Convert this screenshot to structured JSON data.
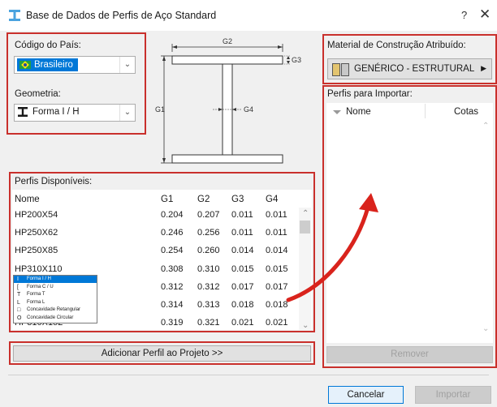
{
  "window": {
    "title": "Base de Dados de Perfis de Aço Standard",
    "help": "?",
    "close": "✕"
  },
  "country": {
    "label": "Código do País:",
    "value": "Brasileiro"
  },
  "geometry": {
    "label": "Geometria:",
    "value": "Forma I / H",
    "options": [
      "Forma I / H",
      "Forma C / U",
      "Forma T",
      "Forma L",
      "Concavidade Retangular",
      "Concavidade Circular"
    ]
  },
  "diagram": {
    "g1": "G1",
    "g2": "G2",
    "g3": "G3",
    "g4": "G4"
  },
  "available": {
    "label": "Perfis Disponíveis:",
    "columns": [
      "Nome",
      "G1",
      "G2",
      "G3",
      "G4"
    ],
    "rows": [
      [
        "HP200X54",
        "0.204",
        "0.207",
        "0.011",
        "0.011"
      ],
      [
        "HP250X62",
        "0.246",
        "0.256",
        "0.011",
        "0.011"
      ],
      [
        "HP250X85",
        "0.254",
        "0.260",
        "0.014",
        "0.014"
      ],
      [
        "HP310X110",
        "0.308",
        "0.310",
        "0.015",
        "0.015"
      ],
      [
        "",
        "0.312",
        "0.312",
        "0.017",
        "0.017"
      ],
      [
        "",
        "0.314",
        "0.313",
        "0.018",
        "0.018"
      ],
      [
        "HP310X152",
        "0.319",
        "0.321",
        "0.021",
        "0.021"
      ]
    ]
  },
  "add_button": "Adicionar Perfil ao Projeto >>",
  "material": {
    "label": "Material de Construção Atribuído:",
    "value": "GENÉRICO - ESTRUTURAL"
  },
  "import": {
    "label": "Perfis para Importar:",
    "columns": [
      "Nome",
      "Cotas"
    ]
  },
  "remove_button": "Remover",
  "cancel_button": "Cancelar",
  "import_button": "Importar",
  "colors": {
    "highlight": "#c9302c",
    "selection": "#0078d7"
  }
}
